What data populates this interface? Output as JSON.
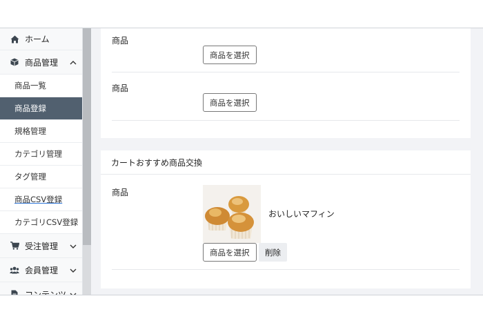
{
  "sidebar": {
    "home": {
      "label": "ホーム",
      "icon": "home-icon"
    },
    "product_mgmt": {
      "label": "商品管理",
      "icon": "box-icon"
    },
    "items": [
      {
        "label": "商品一覧"
      },
      {
        "label": "商品登録",
        "active": true
      },
      {
        "label": "規格管理"
      },
      {
        "label": "カテゴリ管理"
      },
      {
        "label": "タグ管理"
      },
      {
        "label": "商品CSV登録"
      },
      {
        "label": "カテゴリCSV登録"
      }
    ],
    "order_mgmt": {
      "label": "受注管理",
      "icon": "cart-icon"
    },
    "member_mgmt": {
      "label": "会員管理",
      "icon": "users-icon"
    },
    "content": {
      "label": "コンテンツ",
      "icon": "file-icon"
    }
  },
  "card1": {
    "rows": [
      {
        "label": "商品",
        "button": "商品を選択"
      },
      {
        "label": "商品",
        "button": "商品を選択"
      }
    ]
  },
  "card2": {
    "title": "カートおすすめ商品交換",
    "row": {
      "label": "商品",
      "product_name": "おいしいマフィン",
      "select_button": "商品を選択",
      "delete_button": "削除"
    }
  },
  "colors": {
    "active_bg": "#51606f",
    "page_bg": "#f2f3f6"
  }
}
